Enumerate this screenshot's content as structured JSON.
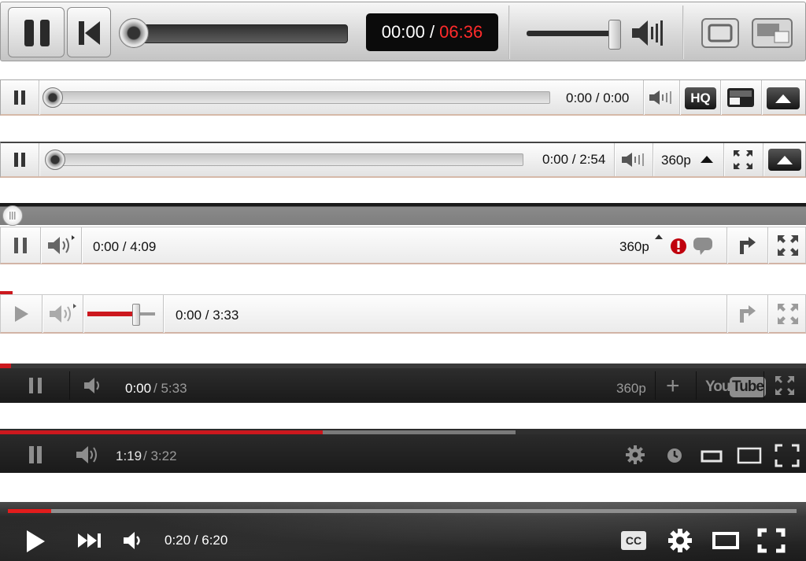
{
  "colors": {
    "accent_red": "#cc181e",
    "time_total_red": "#ff2b2b",
    "dark_bar": "#1b1b1b",
    "light_bar": "#f2f2f2"
  },
  "player_2006": {
    "time_current": "00:00",
    "time_separator": " / ",
    "time_total": "06:36",
    "icons": [
      "pause-icon",
      "skip-back-icon",
      "seek-knob",
      "volume-icon",
      "fullscreen-icon",
      "popout-icon"
    ]
  },
  "player_2008": {
    "time": "0:00 / 0:00",
    "hq_label": "HQ",
    "icons": [
      "pause-icon",
      "volume-icon",
      "hq-icon",
      "popout-icon",
      "fullscreen-icon"
    ]
  },
  "player_2009": {
    "time": "0:00 / 2:54",
    "quality": "360p",
    "icons": [
      "pause-icon",
      "volume-icon",
      "quality-arrow-icon",
      "expand-icon",
      "fullscreen-icon"
    ]
  },
  "player_2010a": {
    "time": "0:00 / 4:09",
    "quality": "360p",
    "icons": [
      "pause-icon",
      "volume-icon",
      "alert-icon",
      "speech-bubble-icon",
      "popout-arrow-icon",
      "fullscreen-icon"
    ]
  },
  "player_2010b": {
    "time": "0:00 / 3:33",
    "volume_level": 0.75,
    "icons": [
      "play-icon",
      "volume-icon",
      "volume-slider",
      "popout-arrow-icon",
      "fullscreen-icon"
    ]
  },
  "player_2011": {
    "time_current": "0:00",
    "time_rest": " / 5:33",
    "quality": "360p",
    "plus_label": "+",
    "logo_text": "You",
    "logo_tube": "Tube",
    "icons": [
      "pause-icon",
      "volume-icon",
      "plus-icon",
      "youtube-logo",
      "fullscreen-icon"
    ]
  },
  "player_2012": {
    "time_current": "1:19",
    "time_rest": " / 3:22",
    "played_fraction": 0.4,
    "buffered_fraction": 0.64,
    "icons": [
      "pause-icon",
      "volume-icon",
      "settings-icon",
      "watch-later-icon",
      "small-player-icon",
      "theater-icon",
      "fullscreen-icon"
    ]
  },
  "player_2015": {
    "time": "0:20 / 6:20",
    "cc_label": "CC",
    "played_fraction": 0.055,
    "icons": [
      "play-icon",
      "next-icon",
      "volume-icon",
      "cc-icon",
      "settings-icon",
      "theater-icon",
      "fullscreen-icon"
    ]
  }
}
